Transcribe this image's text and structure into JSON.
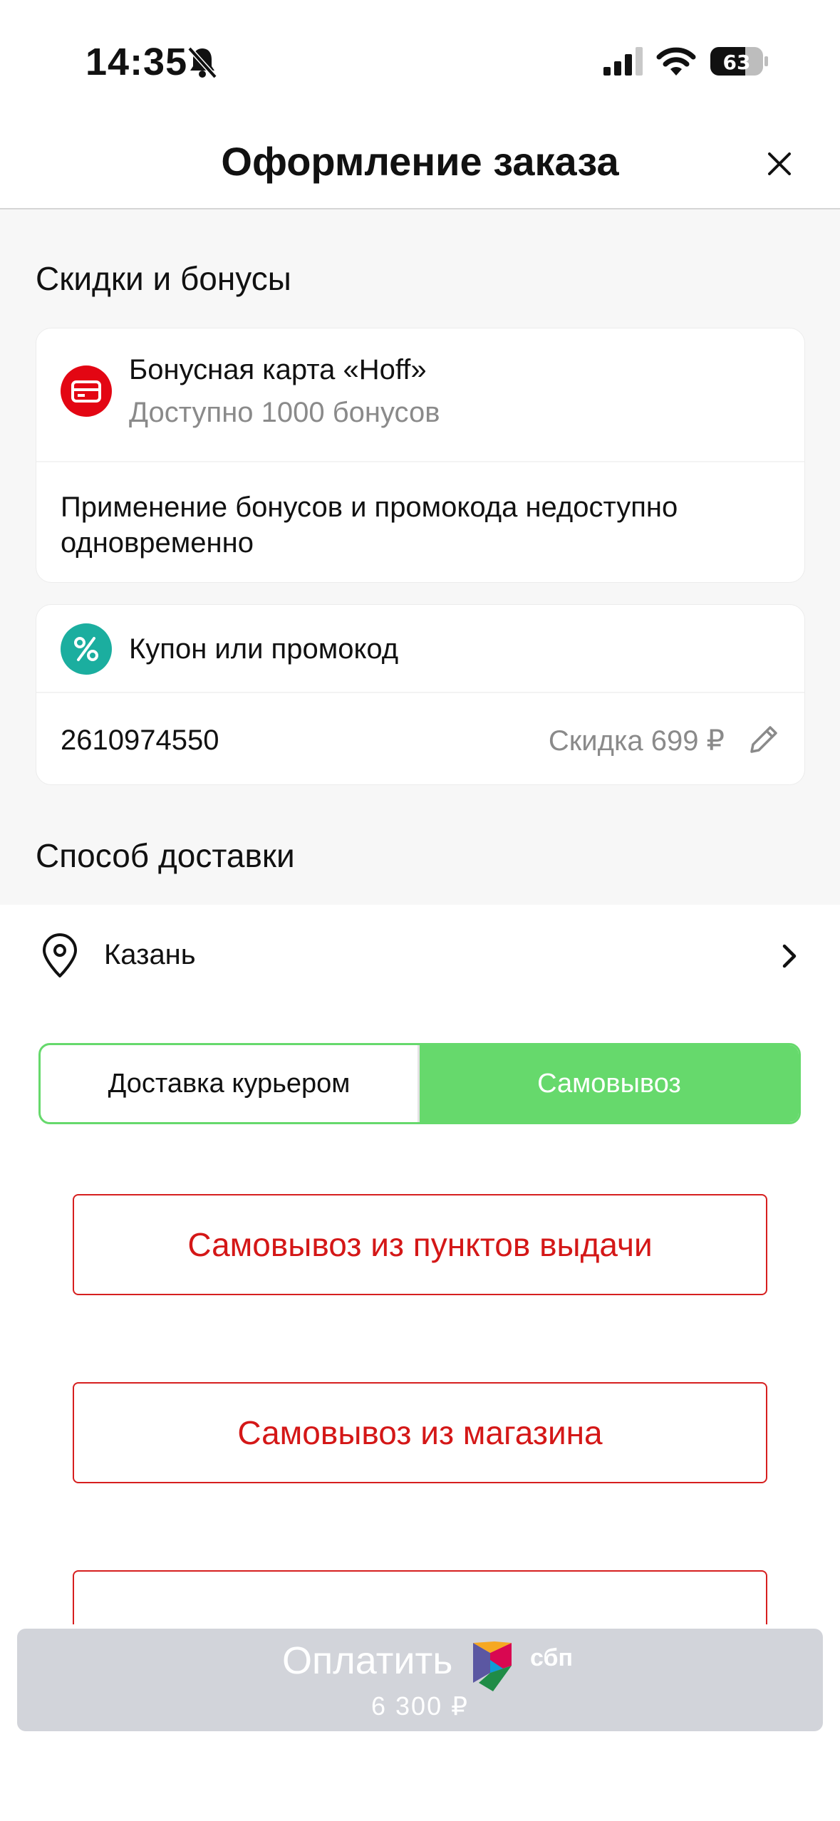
{
  "status_bar": {
    "time": "14:35",
    "battery": "63"
  },
  "header": {
    "title": "Оформление заказа"
  },
  "discounts": {
    "section_title": "Скидки и бонусы",
    "bonus_card": {
      "title": "Бонусная карта «Hoff»",
      "subtitle": "Доступно 1000 бонусов",
      "notice": "Применение бонусов и промокода недоступно одновременно"
    },
    "coupon": {
      "title": "Купон или промокод",
      "code": "2610974550",
      "discount": "Скидка 699 ₽"
    }
  },
  "delivery": {
    "section_title": "Способ доставки",
    "city": "Казань",
    "tabs": [
      "Доставка курьером",
      "Самовывоз"
    ],
    "selected_tab": "Самовывоз",
    "options": [
      "Самовывоз из пунктов выдачи",
      "Самовывоз из магазина"
    ]
  },
  "payment": {
    "label": "Оплатить",
    "sbp": "сбп",
    "amount": "6 300 ₽"
  },
  "colors": {
    "accent_green": "#66d96c",
    "accent_red": "#d41717",
    "teal": "#1bae9f",
    "pay_disabled": "#d2d4da"
  }
}
